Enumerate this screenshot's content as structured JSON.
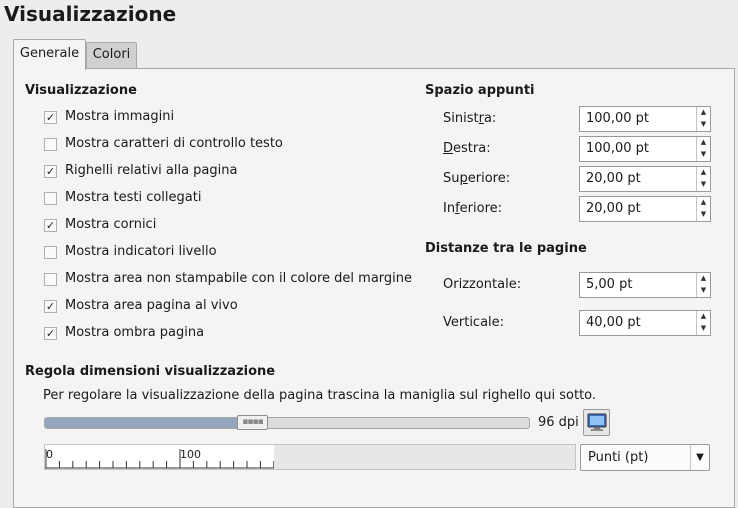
{
  "page_title": "Visualizzazione",
  "tabs": [
    {
      "label": "Generale",
      "active": true
    },
    {
      "label": "Colori",
      "active": false
    }
  ],
  "display_section": {
    "heading": "Visualizzazione",
    "options": [
      {
        "label": "Mostra immagini",
        "checked": true
      },
      {
        "label": "Mostra caratteri di controllo testo",
        "checked": false
      },
      {
        "label": "Righelli relativi alla pagina",
        "checked": true
      },
      {
        "label": "Mostra testi collegati",
        "checked": false
      },
      {
        "label": "Mostra cornici",
        "checked": true
      },
      {
        "label": "Mostra indicatori livello",
        "checked": false
      },
      {
        "label": "Mostra area non stampabile con il colore del margine",
        "checked": false
      },
      {
        "label": "Mostra area pagina al vivo",
        "checked": true
      },
      {
        "label": "Mostra ombra pagina",
        "checked": true
      }
    ]
  },
  "scratch_space": {
    "heading": "Spazio appunti",
    "left": {
      "label_pre": "Sinist",
      "label_u": "r",
      "label_post": "a:",
      "value": "100,00 pt"
    },
    "right": {
      "label_pre": "",
      "label_u": "D",
      "label_post": "estra:",
      "value": "100,00 pt"
    },
    "top": {
      "label_pre": "Su",
      "label_u": "p",
      "label_post": "eriore:",
      "value": "20,00 pt"
    },
    "bottom": {
      "label_pre": "In",
      "label_u": "f",
      "label_post": "eriore:",
      "value": "20,00 pt"
    }
  },
  "page_gaps": {
    "heading": "Distanze tra le pagine",
    "horizontal": {
      "label": "Orizzontale:",
      "value": "5,00 pt"
    },
    "vertical": {
      "label": "Verticale:",
      "value": "40,00 pt"
    }
  },
  "display_size": {
    "heading": "Regola dimensioni visualizzazione",
    "hint": "Per regolare la visualizzazione della pagina trascina la maniglia sul righello qui sotto.",
    "dpi_value": "96 dpi",
    "slider_fraction": 0.43,
    "ruler_labels": [
      "0",
      "100"
    ],
    "unit": "Punti (pt)"
  }
}
